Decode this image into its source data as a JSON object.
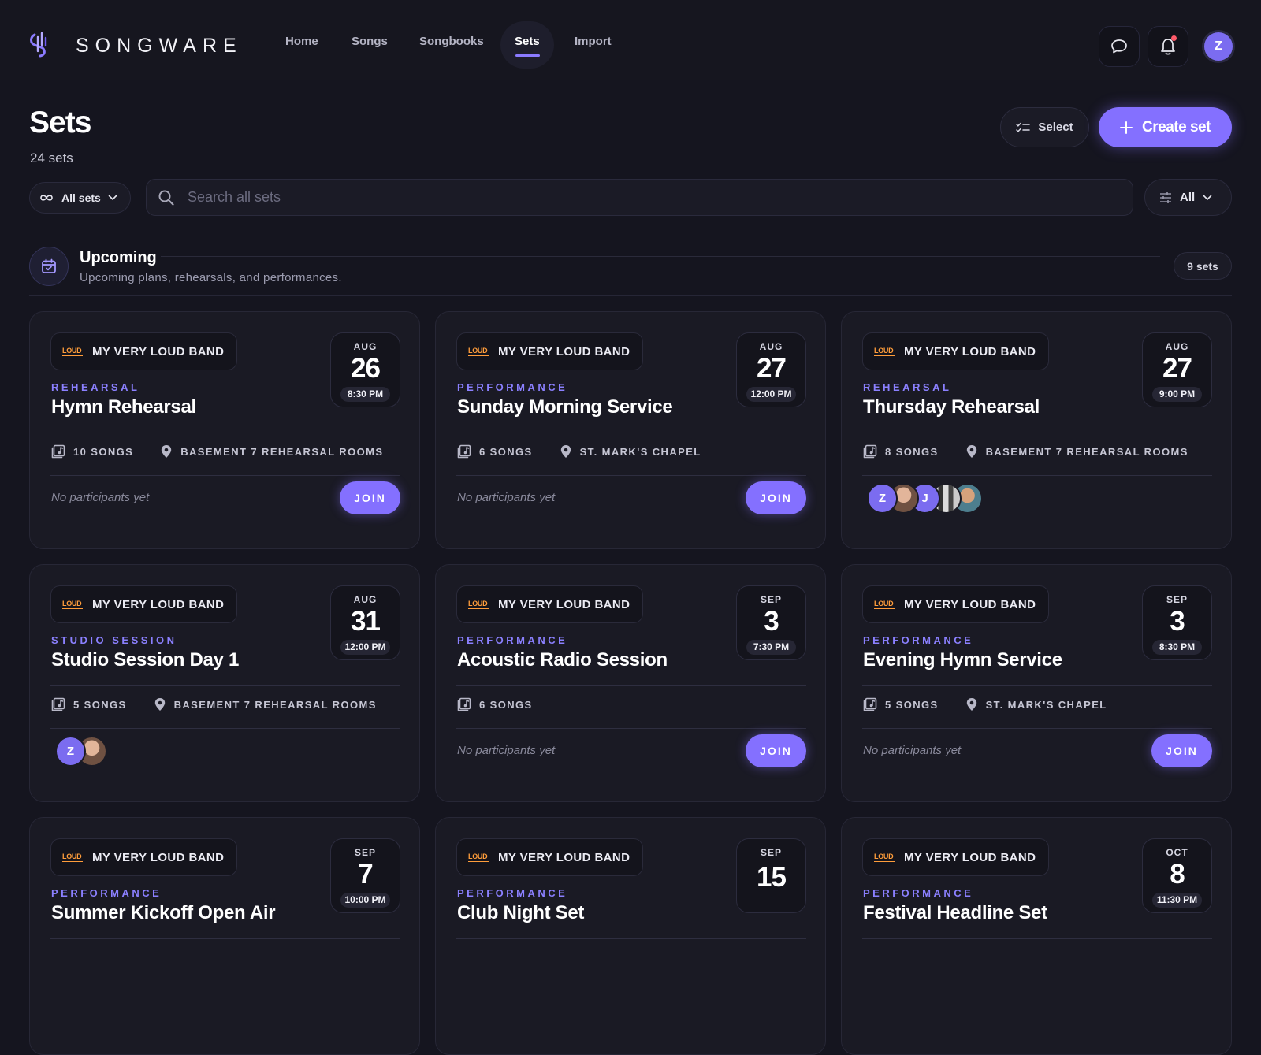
{
  "app": {
    "brand": "SONGWARE",
    "nav": [
      "Home",
      "Songs",
      "Songbooks",
      "Sets",
      "Import"
    ],
    "active_nav": "Sets",
    "user_initial": "Z",
    "has_notification": true
  },
  "page": {
    "title": "Sets",
    "count": "24 sets",
    "select_label": "Select",
    "create_label": "Create set"
  },
  "filters": {
    "scope_label": "All sets",
    "search_placeholder": "Search all sets",
    "filter_label": "All"
  },
  "section": {
    "title": "Upcoming",
    "subtitle": "Upcoming plans, rehearsals, and performances.",
    "count": "9 sets"
  },
  "cards": [
    {
      "band": "MY VERY LOUD BAND",
      "month": "AUG",
      "day": "26",
      "time": "8:30 PM",
      "type": "REHEARSAL",
      "name": "Hymn Rehearsal",
      "songs": "10 SONGS",
      "location": "BASEMENT 7 REHEARSAL ROOMS",
      "participants_text": "No participants yet",
      "join_label": "JOIN"
    },
    {
      "band": "MY VERY LOUD BAND",
      "month": "AUG",
      "day": "27",
      "time": "12:00 PM",
      "type": "PERFORMANCE",
      "name": "Sunday Morning Service",
      "songs": "6 SONGS",
      "location": "ST. MARK'S CHAPEL",
      "participants_text": "No participants yet",
      "join_label": "JOIN"
    },
    {
      "band": "MY VERY LOUD BAND",
      "month": "AUG",
      "day": "27",
      "time": "9:00 PM",
      "type": "REHEARSAL",
      "name": "Thursday Rehearsal",
      "songs": "8 SONGS",
      "location": "BASEMENT 7 REHEARSAL ROOMS",
      "participants": [
        "Z",
        "photo",
        "J",
        "photo3",
        "photo2"
      ]
    },
    {
      "band": "MY VERY LOUD BAND",
      "month": "AUG",
      "day": "31",
      "time": "12:00 PM",
      "type": "STUDIO SESSION",
      "name": "Studio Session Day 1",
      "songs": "5 SONGS",
      "location": "BASEMENT 7 REHEARSAL ROOMS",
      "participants": [
        "Z",
        "photo"
      ]
    },
    {
      "band": "MY VERY LOUD BAND",
      "month": "SEP",
      "day": "3",
      "time": "7:30 PM",
      "type": "PERFORMANCE",
      "name": "Acoustic Radio Session",
      "songs": "6 SONGS",
      "location": "",
      "participants_text": "No participants yet",
      "join_label": "JOIN"
    },
    {
      "band": "MY VERY LOUD BAND",
      "month": "SEP",
      "day": "3",
      "time": "8:30 PM",
      "type": "PERFORMANCE",
      "name": "Evening Hymn Service",
      "songs": "5 SONGS",
      "location": "ST. MARK'S CHAPEL",
      "participants_text": "No participants yet",
      "join_label": "JOIN"
    },
    {
      "band": "MY VERY LOUD BAND",
      "month": "SEP",
      "day": "7",
      "time": "10:00 PM",
      "type": "PERFORMANCE",
      "name": "Summer Kickoff Open Air",
      "songs": "",
      "location": ""
    },
    {
      "band": "MY VERY LOUD BAND",
      "month": "SEP",
      "day": "15",
      "time": "",
      "type": "PERFORMANCE",
      "name": "Club Night Set",
      "songs": "",
      "location": ""
    },
    {
      "band": "MY VERY LOUD BAND",
      "month": "OCT",
      "day": "8",
      "time": "11:30 PM",
      "type": "PERFORMANCE",
      "name": "Festival Headline Set",
      "songs": "",
      "location": ""
    }
  ],
  "colors": {
    "accent": "#8470ff",
    "type_label": "#8b80ff",
    "background": "#15151f",
    "card": "#1a1a24"
  }
}
